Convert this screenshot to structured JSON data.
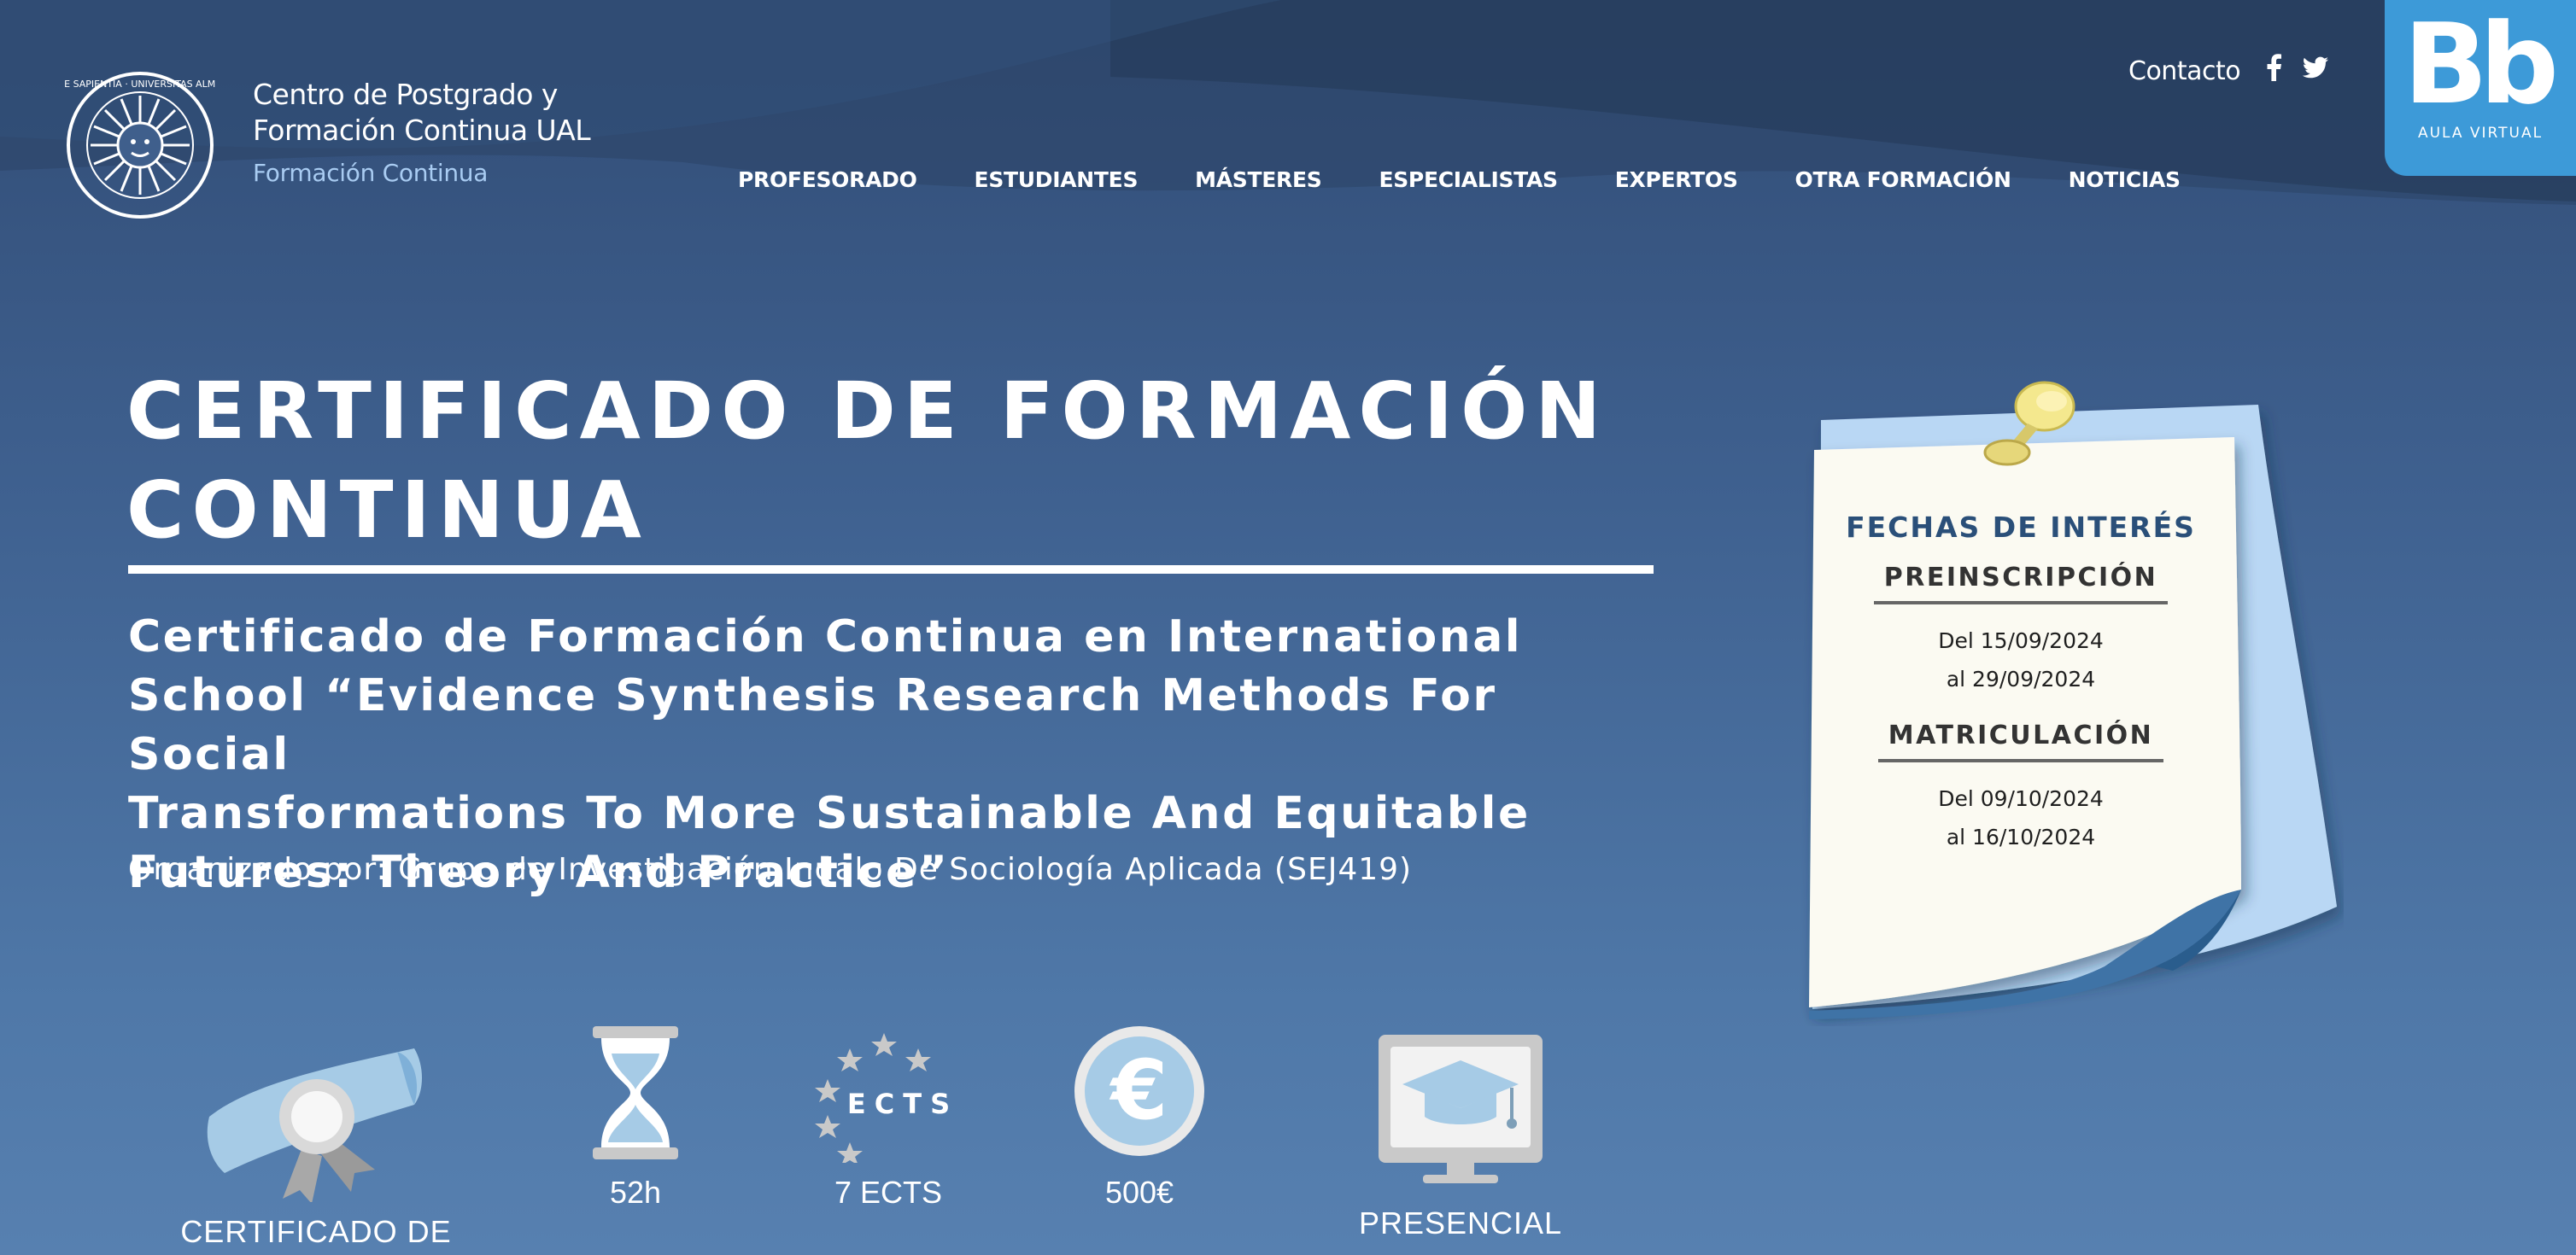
{
  "header": {
    "brand_line1": "Centro de Postgrado y",
    "brand_line2": "Formación Continua UAL",
    "brand_sub": "Formación Continua",
    "seal_text": "IN LUMINE SAPIENTIA · UNIVERSITAS ALMERIENSIS",
    "contact": "Contacto",
    "nav": [
      "PROFESORADO",
      "ESTUDIANTES",
      "MÁSTERES",
      "ESPECIALISTAS",
      "EXPERTOS",
      "OTRA FORMACIÓN",
      "NOTICIAS"
    ],
    "aula": {
      "logo": "Bb",
      "label": "AULA VIRTUAL"
    }
  },
  "main": {
    "title_line1": "CERTIFICADO DE FORMACIÓN",
    "title_line2": "CONTINUA",
    "course_line1": "Certificado de Formación Continua en International",
    "course_line2": "School “Evidence Synthesis Research Methods For Social",
    "course_line3": "Transformations To More Sustainable And Equitable",
    "course_line4": "Futures: Theory And Practice”",
    "organizer": "Organizado por: Grupo de Investigación Indalo De Sociología Aplicada (SEJ419)"
  },
  "dates": {
    "heading": "FECHAS DE INTERÉS",
    "pre_label": "PREINSCRIPCIÓN",
    "pre_from": "Del 15/09/2024",
    "pre_to": "al 29/09/2024",
    "mat_label": "MATRICULACIÓN",
    "mat_from": "Del 09/10/2024",
    "mat_to": "al 16/10/2024"
  },
  "features": {
    "certificate": "CERTIFICADO DE",
    "hours": "52h",
    "ects_badge": "ECTS",
    "ects": "7 ECTS",
    "price_symbol": "€",
    "price": "500€",
    "mode": "PRESENCIAL"
  },
  "colors": {
    "background_top": "#314c75",
    "background_bottom": "#5780b0",
    "accent_blue": "#3d9ad8",
    "brand_sub": "#a9ccf2",
    "note_paper": "#fbfaf2",
    "note_back": "#b9d7f4",
    "heading_blue": "#2a4f79"
  }
}
